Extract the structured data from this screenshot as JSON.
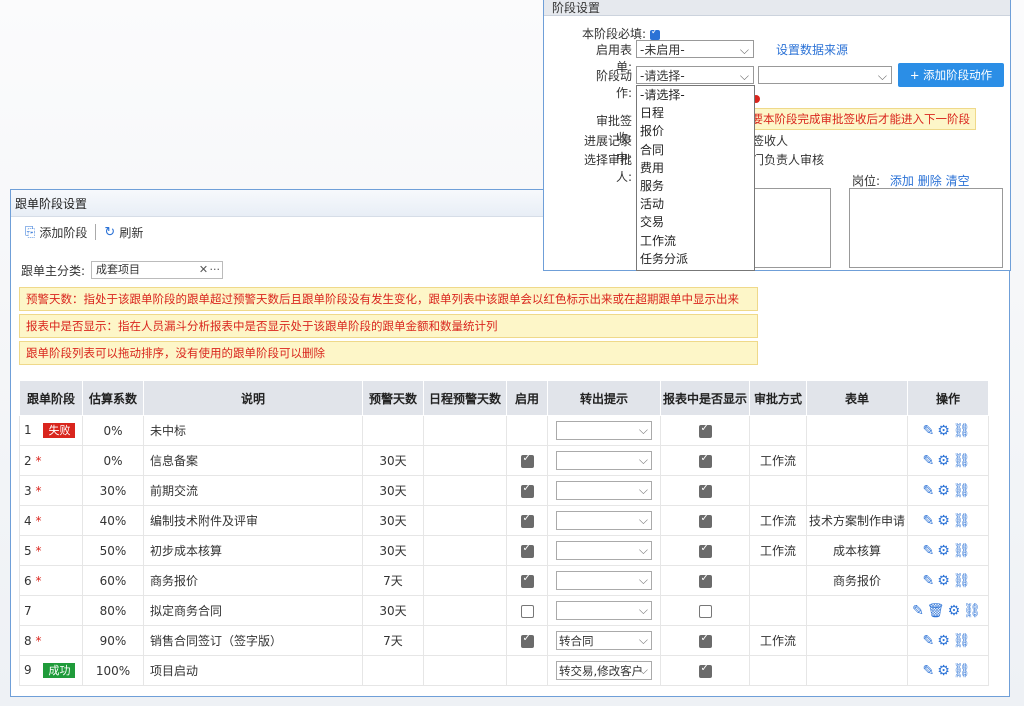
{
  "main": {
    "title": "跟单阶段设置",
    "toolbar": {
      "add_label": "添加阶段",
      "refresh_label": "刷新"
    },
    "filter": {
      "label": "跟单主分类:",
      "value": "成套项目",
      "clear": "✕",
      "more": "···"
    },
    "notes": [
      "预警天数：指处于该跟单阶段的跟单超过预警天数后且跟单阶段没有发生变化，跟单列表中该跟单会以红色标示出来或在超期跟单中显示出来",
      "报表中是否显示：指在人员漏斗分析报表中是否显示处于该跟单阶段的跟单金额和数量统计列",
      "跟单阶段列表可以拖动排序，没有使用的跟单阶段可以删除"
    ],
    "table": {
      "headers": [
        "跟单阶段",
        "估算系数",
        "说明",
        "预警天数",
        "日程预警天数",
        "启用",
        "转出提示",
        "报表中是否显示",
        "审批方式",
        "表单",
        "操作"
      ],
      "rows": [
        {
          "stage": "1",
          "star": "",
          "badge": "失败",
          "badge_type": "fail",
          "coef": "0%",
          "desc": "未中标",
          "warn": "",
          "sched": "",
          "enable": null,
          "transfer": "",
          "report": true,
          "approve": "",
          "form": "",
          "ops": "✎⚙⛓"
        },
        {
          "stage": "2",
          "star": "*",
          "badge": "",
          "badge_type": "",
          "coef": "0%",
          "desc": "信息备案",
          "warn": "30天",
          "sched": "",
          "enable": true,
          "transfer": "",
          "report": true,
          "approve": "工作流",
          "form": "",
          "ops": "✎⚙⛓"
        },
        {
          "stage": "3",
          "star": "*",
          "badge": "",
          "badge_type": "",
          "coef": "30%",
          "desc": "前期交流",
          "warn": "30天",
          "sched": "",
          "enable": true,
          "transfer": "",
          "report": true,
          "approve": "",
          "form": "",
          "ops": "✎⚙⛓"
        },
        {
          "stage": "4",
          "star": "*",
          "badge": "",
          "badge_type": "",
          "coef": "40%",
          "desc": "编制技术附件及评审",
          "warn": "30天",
          "sched": "",
          "enable": true,
          "transfer": "",
          "report": true,
          "approve": "工作流",
          "form": "技术方案制作申请",
          "ops": "✎⚙⛓"
        },
        {
          "stage": "5",
          "star": "*",
          "badge": "",
          "badge_type": "",
          "coef": "50%",
          "desc": "初步成本核算",
          "warn": "30天",
          "sched": "",
          "enable": true,
          "transfer": "",
          "report": true,
          "approve": "工作流",
          "form": "成本核算",
          "ops": "✎⚙⛓"
        },
        {
          "stage": "6",
          "star": "*",
          "badge": "",
          "badge_type": "",
          "coef": "60%",
          "desc": "商务报价",
          "warn": "7天",
          "sched": "",
          "enable": true,
          "transfer": "",
          "report": true,
          "approve": "",
          "form": "商务报价",
          "ops": "✎⚙⛓"
        },
        {
          "stage": "7",
          "star": "",
          "badge": "",
          "badge_type": "",
          "coef": "80%",
          "desc": "拟定商务合同",
          "warn": "30天",
          "sched": "",
          "enable": false,
          "transfer": "",
          "report": false,
          "approve": "",
          "form": "",
          "ops": "✎🗑⚙⛓"
        },
        {
          "stage": "8",
          "star": "*",
          "badge": "",
          "badge_type": "",
          "coef": "90%",
          "desc": "销售合同签订（签字版）",
          "warn": "7天",
          "sched": "",
          "enable": true,
          "transfer": "转合同",
          "report": true,
          "approve": "工作流",
          "form": "",
          "ops": "✎⚙⛓"
        },
        {
          "stage": "9",
          "star": "",
          "badge": "成功",
          "badge_type": "ok",
          "coef": "100%",
          "desc": "项目启动",
          "warn": "",
          "sched": "",
          "enable": null,
          "transfer": "转交易,修改客户",
          "report": true,
          "approve": "",
          "form": "",
          "ops": "✎⚙⛓"
        }
      ]
    }
  },
  "panel": {
    "title": "阶段设置",
    "required_label": "本阶段必填:",
    "form_label": "启用表单:",
    "form_value": "-未启用-",
    "datasource_link": "设置数据来源",
    "action_label": "阶段动作:",
    "action_value": "-请选择-",
    "add_action_button": "+ 添加阶段动作",
    "approve_sign_label": "审批签收:",
    "warn_text": "需要本阶段完成审批签收后才能进入下一阶段",
    "progress_label": "进展记录中:",
    "progress_value": "签收人",
    "approver_label": "选择审批人:",
    "approver_value": "门负责人审核",
    "post_label": "岗位:",
    "post_links": [
      "添加",
      "删除",
      "清空"
    ],
    "dropdown_options": [
      "-请选择-",
      "日程",
      "报价",
      "合同",
      "费用",
      "服务",
      "活动",
      "交易",
      "工作流",
      "任务分派"
    ]
  }
}
